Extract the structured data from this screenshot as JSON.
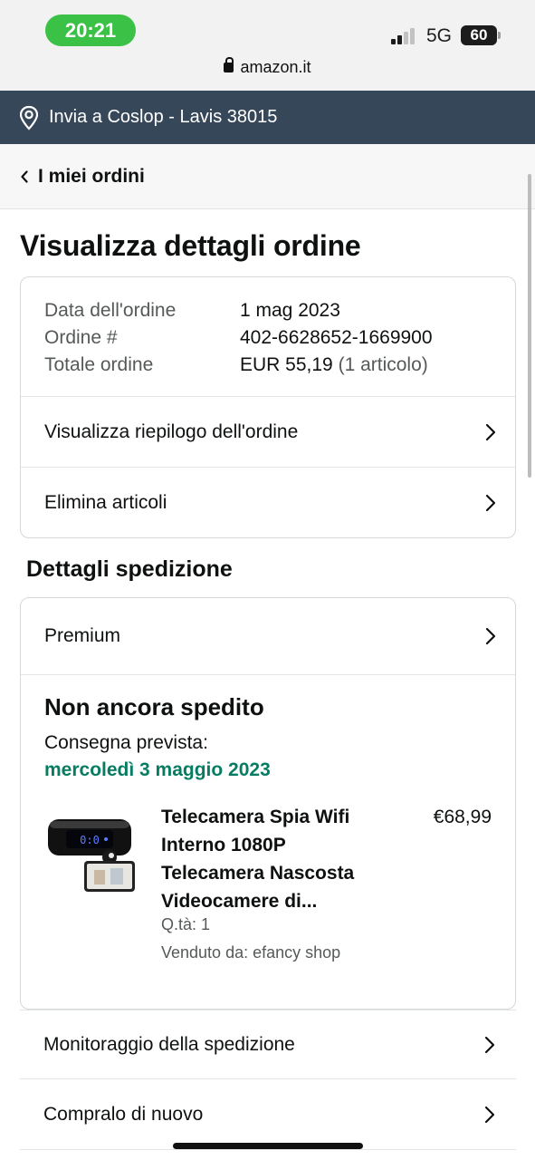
{
  "status_bar": {
    "time": "20:21",
    "network": "5G",
    "battery": "60",
    "url": "amazon.it",
    "accent_color": "#3ac146"
  },
  "delivery_bar": {
    "text": "Invia a Coslop - Lavis 38015",
    "icon": "location-pin-icon",
    "background": "#37475a"
  },
  "nav": {
    "back_label": "I miei ordini"
  },
  "page_title": "Visualizza dettagli ordine",
  "order_summary": {
    "rows": [
      {
        "label": "Data dell'ordine",
        "value": "1 mag 2023",
        "note": ""
      },
      {
        "label": "Ordine #",
        "value": "402-6628652-1669900",
        "note": ""
      },
      {
        "label": "Totale ordine",
        "value": "EUR 55,19",
        "note": "(1 articolo)"
      }
    ],
    "links": [
      {
        "label": "Visualizza riepilogo dell'ordine"
      },
      {
        "label": "Elimina articoli"
      }
    ]
  },
  "shipment": {
    "section_title": "Dettagli spedizione",
    "shipping_type": "Premium",
    "status": "Non ancora spedito",
    "eta_label": "Consegna prevista:",
    "eta_date": "mercoledì 3 maggio 2023",
    "eta_color": "#067d62",
    "item": {
      "title": "Telecamera Spia Wifi Interno 1080P Telecamera Nascosta Videocamere di...",
      "price": "€68,99",
      "quantity": "Q.tà: 1",
      "seller": "Venduto da: efancy shop"
    }
  },
  "actions": [
    {
      "label": "Monitoraggio della spedizione"
    },
    {
      "label": "Compralo di nuovo"
    }
  ]
}
